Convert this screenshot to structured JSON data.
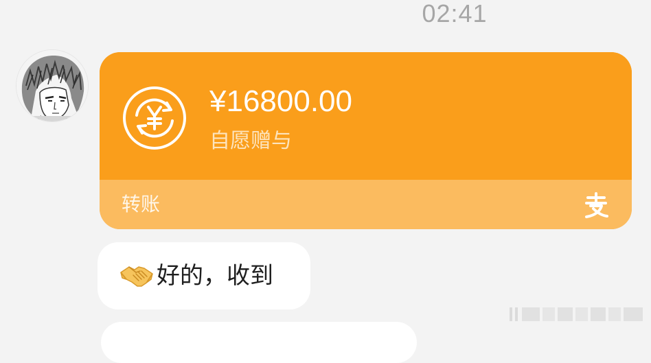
{
  "timestamp": "02:41",
  "transfer_card": {
    "amount": "¥16800.00",
    "remark": "自愿赠与",
    "type_label": "转账",
    "icon": "yuan-exchange-icon",
    "brand_icon": "alipay-icon",
    "colors": {
      "top": "#fa9e1b",
      "bottom": "#fbbb5f",
      "text": "#ffffff"
    }
  },
  "message": {
    "emoji": "handshake-icon",
    "text": "好的，收到"
  }
}
